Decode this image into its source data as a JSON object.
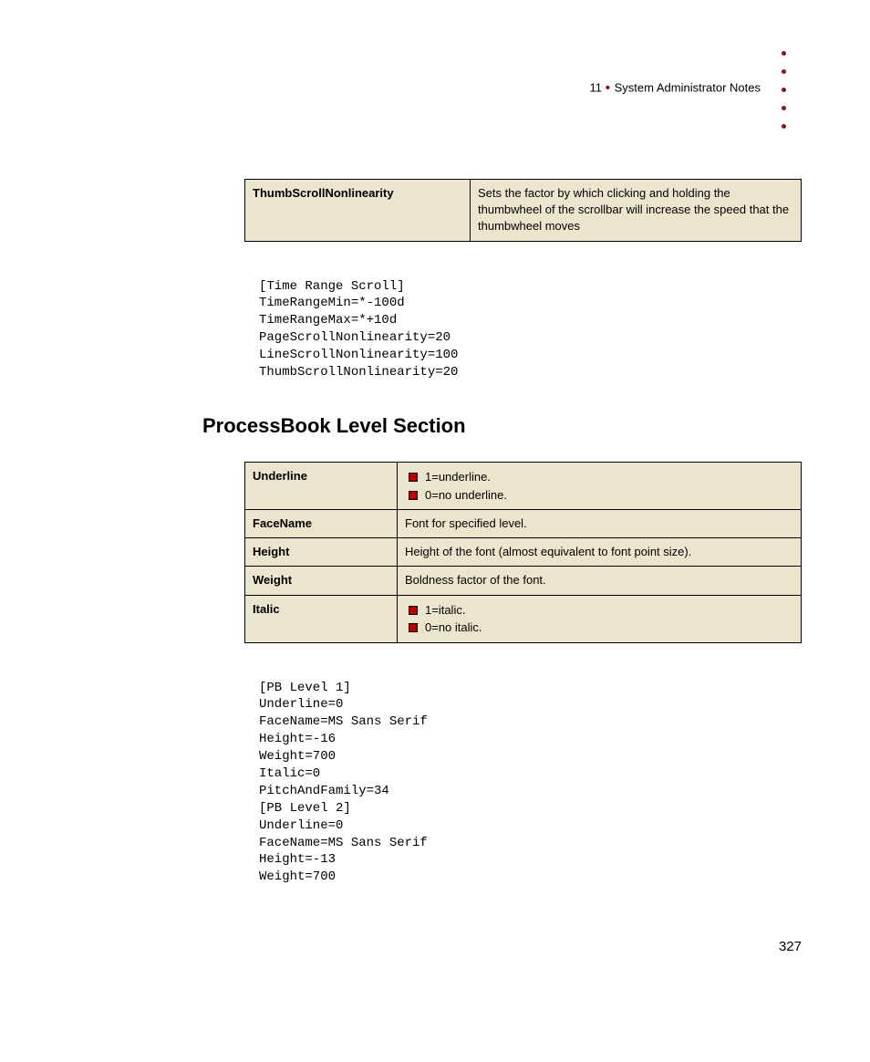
{
  "header": {
    "chapter_num": "11",
    "chapter_title": "System Administrator Notes"
  },
  "table1": {
    "key": "ThumbScrollNonlinearity",
    "desc": "Sets the factor by which clicking and holding the thumbwheel of the scrollbar will increase the speed that the thumbwheel moves"
  },
  "code1": "[Time Range Scroll]\nTimeRangeMin=*-100d\nTimeRangeMax=*+10d\nPageScrollNonlinearity=20\nLineScrollNonlinearity=100\nThumbScrollNonlinearity=20",
  "section_heading": "ProcessBook Level Section",
  "table2": {
    "rows": [
      {
        "key": "Underline",
        "bullets": [
          "1=underline.",
          "0=no underline."
        ]
      },
      {
        "key": "FaceName",
        "desc": "Font for specified level."
      },
      {
        "key": "Height",
        "desc": "Height of the font (almost equivalent to font point size)."
      },
      {
        "key": "Weight",
        "desc": "Boldness factor of the font."
      },
      {
        "key": "Italic",
        "bullets": [
          "1=italic.",
          "0=no italic."
        ]
      }
    ]
  },
  "code2": "[PB Level 1]\nUnderline=0\nFaceName=MS Sans Serif\nHeight=-16\nWeight=700\nItalic=0\nPitchAndFamily=34\n[PB Level 2]\nUnderline=0\nFaceName=MS Sans Serif\nHeight=-13\nWeight=700",
  "page_number": "327"
}
